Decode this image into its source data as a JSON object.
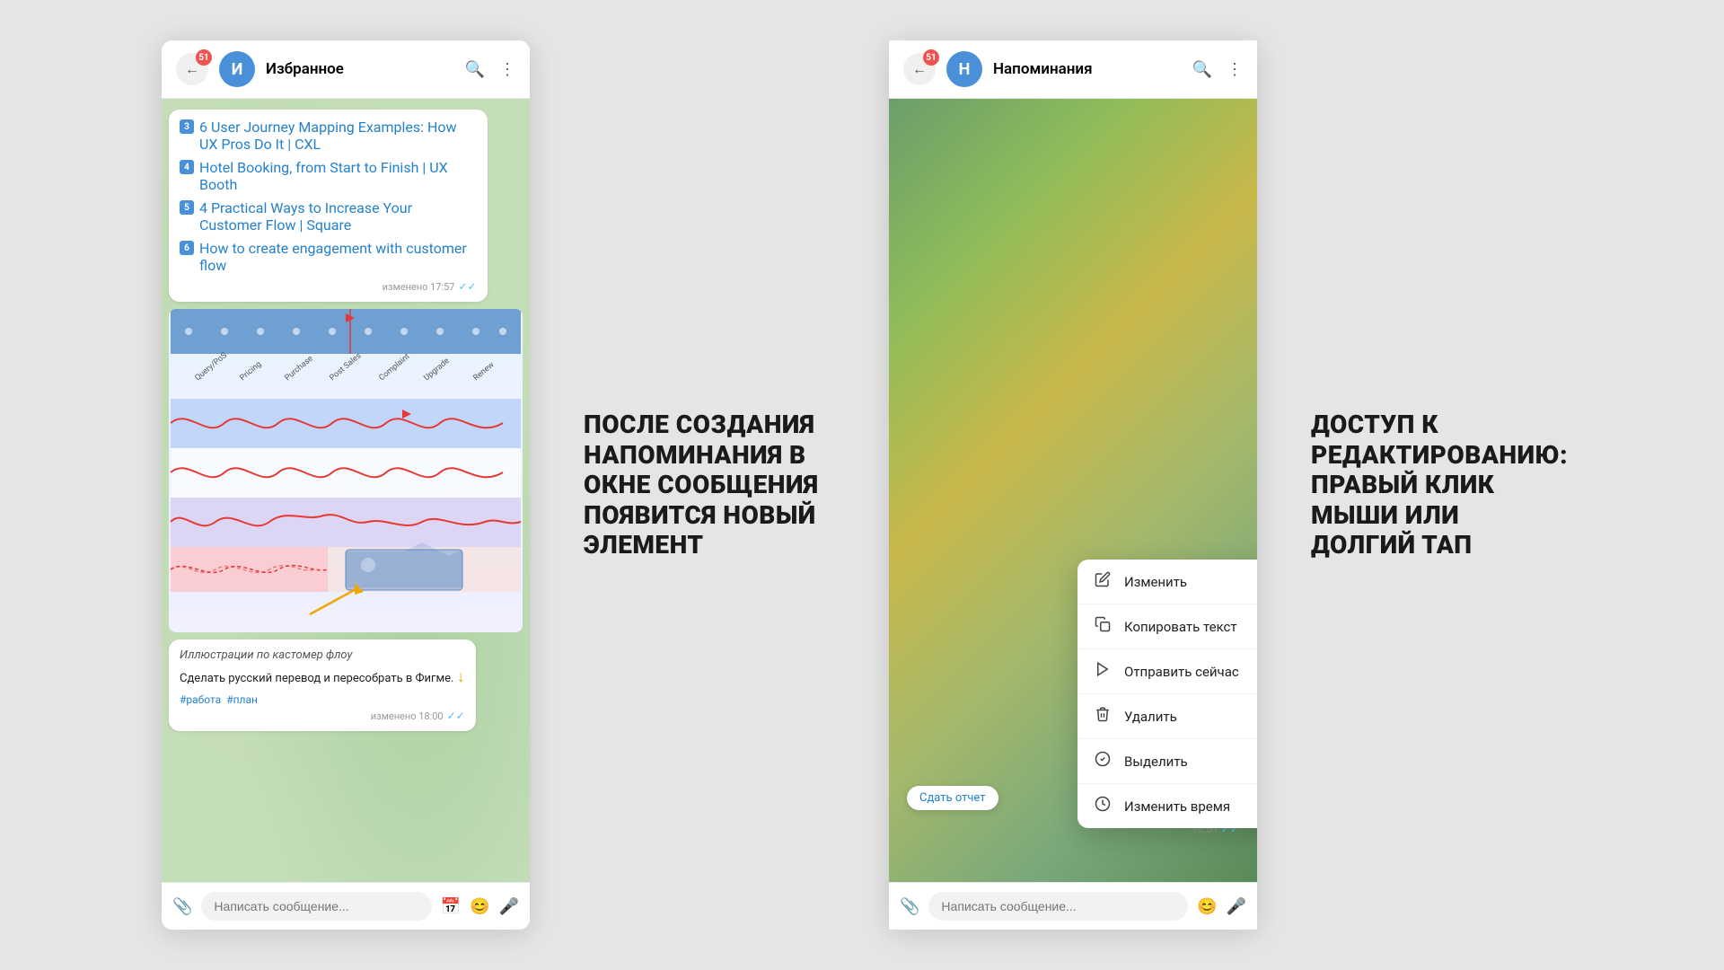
{
  "left_window": {
    "header": {
      "back_badge": "51",
      "avatar_letter": "И",
      "title": "Избранное",
      "search_icon": "🔍",
      "menu_icon": "⋮"
    },
    "messages": [
      {
        "items": [
          {
            "num": "3",
            "text": "6 User Journey Mapping Examples: How UX Pros Do It | CXL"
          },
          {
            "num": "4",
            "text": "Hotel Booking, from Start to Finish | UX Booth"
          },
          {
            "num": "5",
            "text": "4 Practical Ways to Increase Your Customer Flow | Square"
          },
          {
            "num": "6",
            "text": "How to create engagement with customer flow"
          }
        ],
        "time": "изменено 17:57",
        "check": "✓✓"
      }
    ],
    "flow_image_labels": [
      "Query/PoS",
      "Pricing",
      "Purchase",
      "Post Sales support",
      "Complaint",
      "Upgrade",
      "Renew"
    ],
    "description": {
      "caption": "Иллюстрации по кастомер флоу",
      "text": "Сделать русский перевод и пересобрать в Фигме.",
      "tags": [
        "#работа",
        "#план"
      ],
      "time": "изменено 18:00",
      "check": "✓✓"
    },
    "input_placeholder": "Написать сообщение..."
  },
  "middle_annotation": {
    "text": "ПОСЛЕ СОЗДАНИЯ НАПОМИНАНИЯ В ОКНЕ СООБЩЕНИЯ ПОЯВИТСЯ НОВЫЙ ЭЛЕМЕНТ"
  },
  "right_window": {
    "header": {
      "back_badge": "51",
      "avatar_letter": "Н",
      "title": "Напоминания",
      "search_icon": "🔍",
      "menu_icon": "⋮"
    },
    "context_menu": {
      "items": [
        {
          "icon": "✏️",
          "label": "Изменить"
        },
        {
          "icon": "📋",
          "label": "Копировать текст"
        },
        {
          "icon": "📤",
          "label": "Отправить сейчас"
        },
        {
          "icon": "🗑️",
          "label": "Удалить"
        },
        {
          "icon": "☑️",
          "label": "Выделить"
        },
        {
          "icon": "🕐",
          "label": "Изменить время"
        }
      ]
    },
    "report_button": "Сдать отчет",
    "timestamp": "12:51",
    "check": "✓✓",
    "input_placeholder": "Написать сообщение..."
  },
  "right_annotation": {
    "text": "ДОСТУП К РЕДАКТИРОВАНИЮ: ПРАВЫЙ КЛИК МЫШИ ИЛИ ДОЛГИЙ ТАП"
  }
}
